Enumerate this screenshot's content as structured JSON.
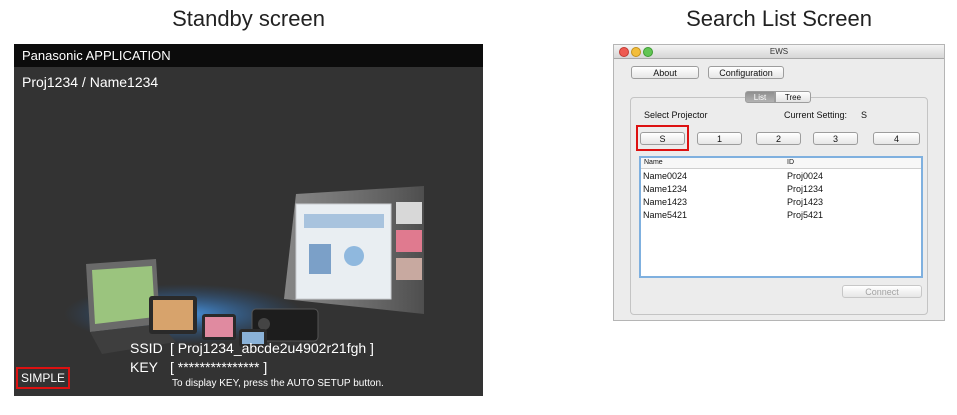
{
  "captions": {
    "left": "Standby screen",
    "right": "Search List Screen"
  },
  "standby": {
    "title": "Panasonic APPLICATION",
    "project_name": "Proj1234 / Name1234",
    "ssid_label": "SSID",
    "ssid_value": "[ Proj1234_abcde2u4902r21fgh ]",
    "key_label": "KEY",
    "key_value": "[ *************** ]",
    "hint": "To display KEY, press the AUTO SETUP button.",
    "mode_button": "SIMPLE"
  },
  "ews": {
    "window_title": "EWS",
    "about_button": "About",
    "configuration_button": "Configuration",
    "tabs": [
      "List",
      "Tree"
    ],
    "selected_tab": "List",
    "select_projector_label": "Select Projector",
    "current_setting_label": "Current Setting:",
    "current_setting_value": "S",
    "slot_buttons": [
      "S",
      "1",
      "2",
      "3",
      "4"
    ],
    "columns": [
      "Name",
      "ID"
    ],
    "rows": [
      {
        "name": "Name0024",
        "id": "Proj0024"
      },
      {
        "name": "Name1234",
        "id": "Proj1234"
      },
      {
        "name": "Name1423",
        "id": "Proj1423"
      },
      {
        "name": "Name5421",
        "id": "Proj5421"
      }
    ],
    "connect_button": "Connect"
  },
  "colors": {
    "highlight": "#dd1111",
    "standby_bg": "#333333",
    "list_border": "#7fb0df"
  }
}
